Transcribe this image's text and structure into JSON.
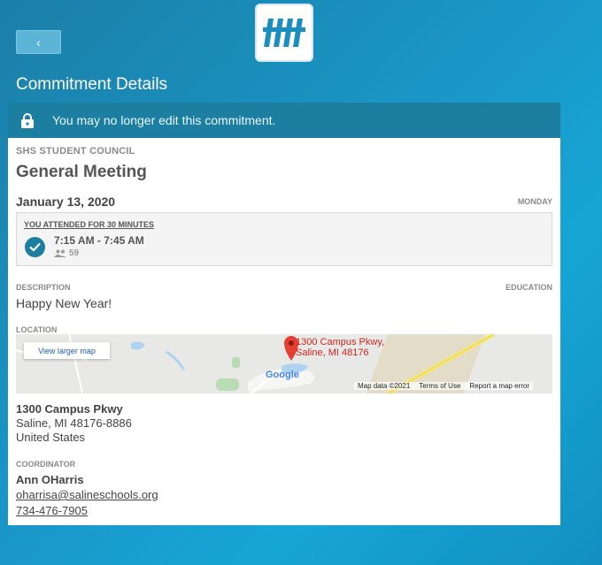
{
  "header": {
    "back_label": "‹",
    "title": "Commitment Details"
  },
  "banner": {
    "text": "You may no longer edit this commitment."
  },
  "event": {
    "organization": "SHS STUDENT COUNCIL",
    "title": "General Meeting",
    "date": "January 13, 2020",
    "weekday": "MONDAY"
  },
  "attendance": {
    "label": "YOU ATTENDED FOR 30 MINUTES",
    "time": "7:15 AM - 7:45 AM",
    "count": "59"
  },
  "description": {
    "label": "DESCRIPTION",
    "category": "EDUCATION",
    "text": "Happy New Year!"
  },
  "location": {
    "label": "LOCATION",
    "map_button": "View larger map",
    "pin_line1": "1300 Campus Pkwy,",
    "pin_line2": "Saline, MI 48176",
    "map_data": "Map data ©2021",
    "terms": "Terms of Use",
    "report": "Report a map error",
    "google": "Google",
    "address_line1": "1300 Campus Pkwy",
    "address_line2": "Saline, MI 48176-8886",
    "address_line3": "United States"
  },
  "coordinator": {
    "label": "COORDINATOR",
    "name": "Ann OHarris",
    "email": "oharrisa@salineschools.org",
    "phone": "734-476-7905"
  },
  "colors": {
    "accent": "#1c7fa1",
    "background": "#1a96c6"
  }
}
